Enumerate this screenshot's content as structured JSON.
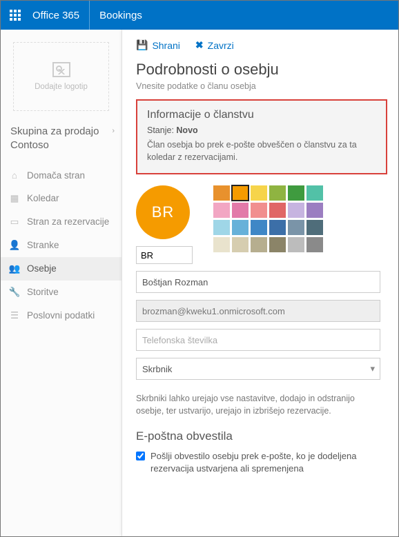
{
  "header": {
    "suite": "Office 365",
    "app": "Bookings"
  },
  "sidebar": {
    "logo_hint": "Dodajte logotip",
    "tenant_line1": "Skupina za prodajo",
    "tenant_line2": "Contoso",
    "items": [
      {
        "label": "Domača stran"
      },
      {
        "label": "Koledar"
      },
      {
        "label": "Stran za rezervacije"
      },
      {
        "label": "Stranke"
      },
      {
        "label": "Osebje"
      },
      {
        "label": "Storitve"
      },
      {
        "label": "Poslovni podatki"
      }
    ]
  },
  "toolbar": {
    "save": "Shrani",
    "discard": "Zavrzi"
  },
  "page": {
    "title": "Podrobnosti o osebju",
    "subtitle": "Vnesite podatke o članu osebja"
  },
  "membership": {
    "heading": "Informacije o članstvu",
    "state_label": "Stanje:",
    "state_value": "Novo",
    "message": "Član osebja bo prek e-pošte obveščen o članstvu za ta koledar z rezervacijami."
  },
  "avatar": {
    "initials": "BR",
    "initials_input": "BR",
    "color": "#f59b00"
  },
  "palette": {
    "selected_index": 1,
    "colors": [
      "#e8912d",
      "#f59b00",
      "#f6d44a",
      "#8fb441",
      "#3f9b3f",
      "#52c1a7",
      "#f2a6c3",
      "#e27aa9",
      "#f18f8f",
      "#e06666",
      "#c6b4e0",
      "#9b7ec1",
      "#9fd6e7",
      "#67b1d9",
      "#3f87c6",
      "#3c6fa8",
      "#7a94a8",
      "#4f6d7a",
      "#e9e3cd",
      "#d6cdb0",
      "#b6ae8f",
      "#8b8468",
      "#bcbcbc",
      "#8a8a8a"
    ]
  },
  "fields": {
    "name_value": "Boštjan Rozman",
    "email_value": "brozman@kweku1.onmicrosoft.com",
    "phone_placeholder": "Telefonska številka",
    "role_value": "Skrbnik",
    "role_help": "Skrbniki lahko urejajo vse nastavitve, dodajo in odstranijo osebje, ter ustvarijo, urejajo in izbrišejo rezervacije."
  },
  "notifications": {
    "heading": "E-poštna obvestila",
    "checkbox_label": "Pošlji obvestilo osebju prek e-pošte, ko je dodeljena rezervacija ustvarjena ali spremenjena"
  }
}
